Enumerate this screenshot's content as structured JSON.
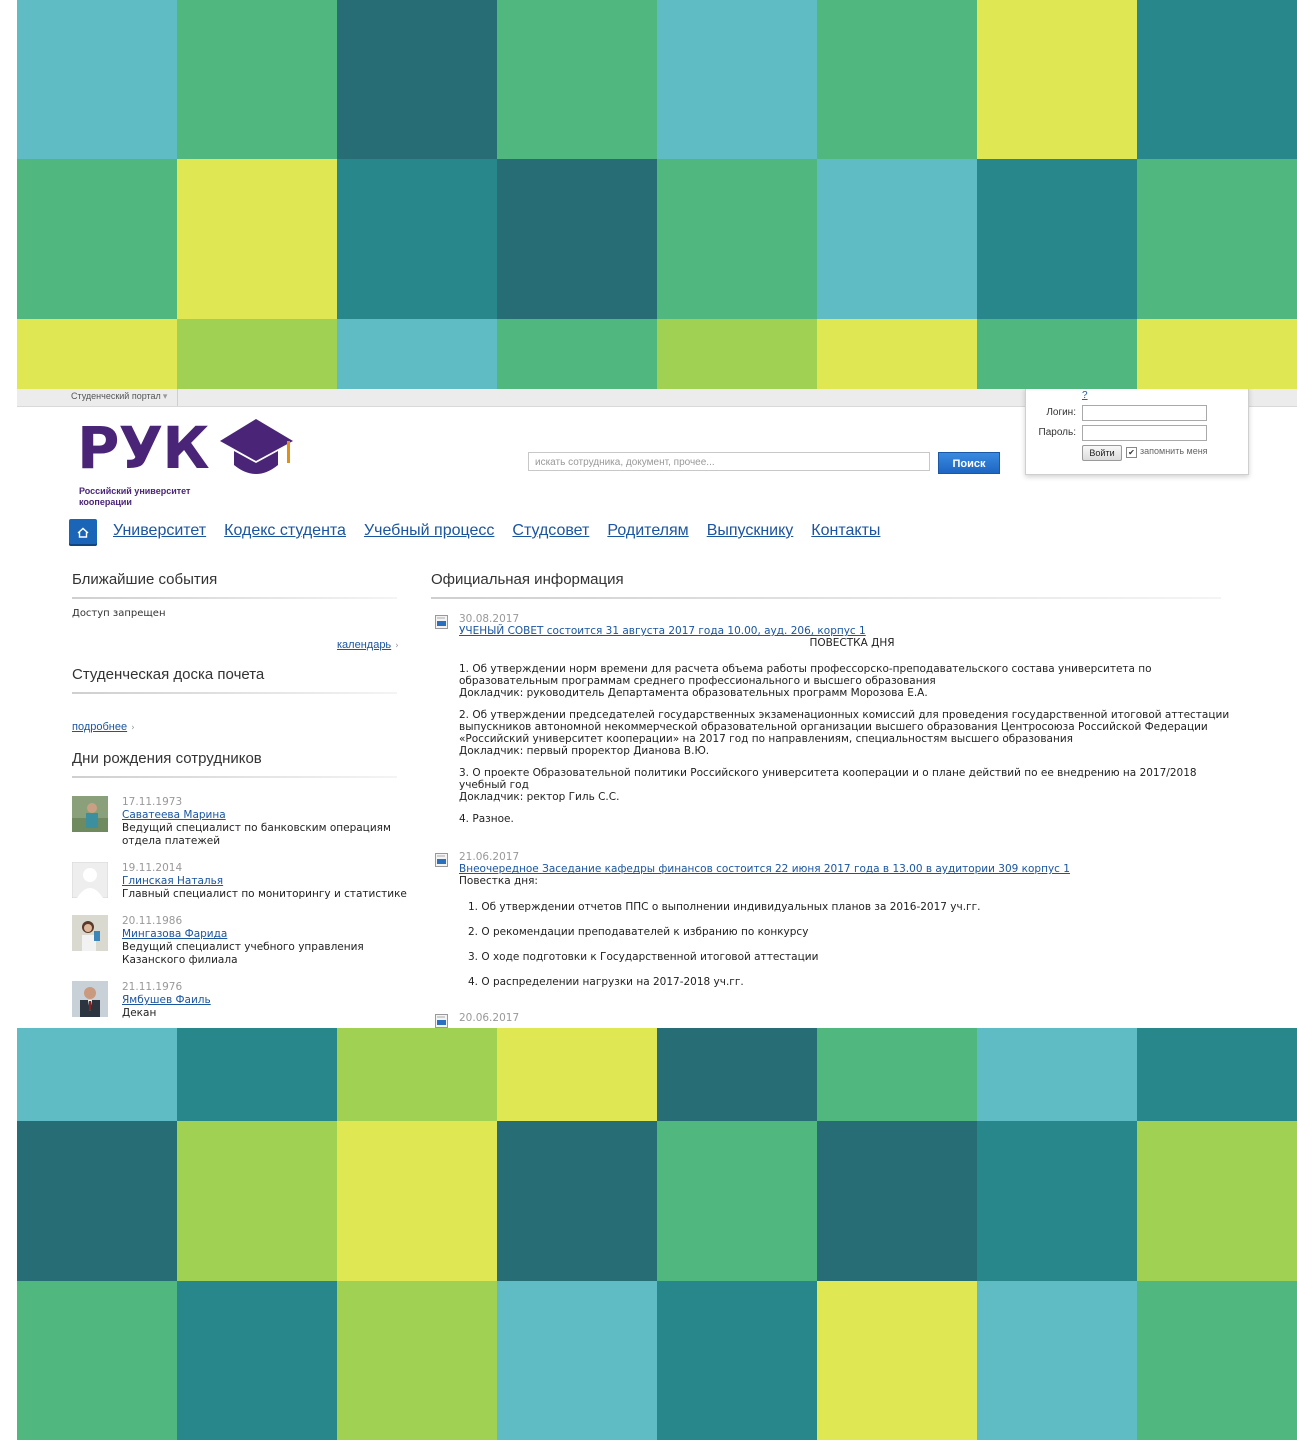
{
  "mosaic": {
    "top_rows": [
      [
        "#5fbcc4",
        "#50b87e",
        "#276d75",
        "#50b87e",
        "#5fbcc4",
        "#50b87e",
        "#dfe852",
        "#27878b"
      ],
      [
        "#50b87e",
        "#dfe852",
        "#27878b",
        "#276d75",
        "#50b87e",
        "#5fbcc4",
        "#27878b",
        "#50b87e"
      ],
      [
        "#dfe852",
        "#a0d153",
        "#5fbcc4",
        "#50b87e",
        "#a0d153",
        "#dfe852",
        "#50b87e",
        "#dfe852"
      ]
    ],
    "bottom_rows": [
      [
        "#5fbcc4",
        "#27878b",
        "#a0d153",
        "#dfe852",
        "#276d75",
        "#50b87e",
        "#5fbcc4",
        "#27878b"
      ],
      [
        "#276d75",
        "#a0d153",
        "#dfe852",
        "#276d75",
        "#50b87e",
        "#276d75",
        "#27878b",
        "#a0d153"
      ],
      [
        "#50b87e",
        "#27878b",
        "#a0d153",
        "#5fbcc4",
        "#27878b",
        "#dfe852",
        "#5fbcc4",
        "#50b87e"
      ]
    ]
  },
  "portal_bar": {
    "label": "Студенческий портал"
  },
  "login": {
    "help": "?",
    "login_label": "Логин:",
    "password_label": "Пароль:",
    "login_button": "Войти",
    "remember_label": "запомнить меня",
    "remember_checked": true
  },
  "logo": {
    "letters": "РУК",
    "tagline": "Российский университет кооперации",
    "brand_color": "#4a2577",
    "accent_color": "#e0901a"
  },
  "search": {
    "placeholder": "искать сотрудника, документ, прочее...",
    "button": "Поиск"
  },
  "nav": {
    "items": [
      "Университет",
      "Кодекс студента",
      "Учебный процесс",
      "Студсовет",
      "Родителям",
      "Выпускнику",
      "Контакты"
    ]
  },
  "sidebar": {
    "events": {
      "title": "Ближайшие события",
      "text": "Доступ запрещен",
      "calendar_link": "календарь"
    },
    "honor": {
      "title": "Студенческая доска почета",
      "more_link": "подробнее"
    },
    "birthdays": {
      "title": "Дни рождения сотрудников",
      "items": [
        {
          "date": "17.11.1973",
          "name": "Саватеева Марина",
          "position": "Ведущий специалист по банковским операциям отдела платежей"
        },
        {
          "date": "19.11.2014",
          "name": "Глинская Наталья",
          "position": "Главный специалист по мониторингу и статистике"
        },
        {
          "date": "20.11.1986",
          "name": "Мингазова Фарида",
          "position": "Ведущий специалист учебного управления Казанского филиала"
        },
        {
          "date": "21.11.1976",
          "name": "Ямбушев Фаиль",
          "position": "Декан"
        }
      ]
    }
  },
  "official": {
    "title": "Официальная информация",
    "news": [
      {
        "date": "30.08.2017",
        "title": "УЧЕНЫЙ СОВЕТ состоится 31 августа 2017 года 10.00, ауд. 206, корпус 1",
        "heading": "ПОВЕСТКА ДНЯ",
        "paragraphs": [
          "1. Об утверждении норм времени для расчета объема работы профессорско-преподавательского состава университета по образовательным программам среднего профессионального и высшего образования",
          "Докладчик: руководитель Департамента образовательных программ Морозова Е.А.",
          "2. Об утверждении председателей государственных экзаменационных комиссий для проведения государственной итоговой аттестации выпускников автономной некоммерческой образовательной организации высшего образования Центросоюза Российской Федерации «Российский университет кооперации» на 2017 год по направлениям, специальностям высшего образования",
          "Докладчик: первый проректор Дианова В.Ю.",
          "3. О проекте Образовательной политики Российского университета кооперации и о плане действий по ее внедрению на 2017/2018 учебный год",
          "Докладчик: ректор Гиль С.С.",
          "4. Разное."
        ]
      },
      {
        "date": "21.06.2017",
        "title": "Внеочередное Заседание кафедры финансов состоится 22 июня 2017 года в 13.00 в аудитории 309 корпус 1",
        "heading": "Повестка дня:",
        "items": [
          "1. Об утверждении отчетов ППС  о выполнении индивидуальных планов за 2016-2017 уч.гг.",
          "2. О рекомендации преподавателей к избранию по конкурсу",
          "3. О ходе подготовки к Государственной итоговой аттестации",
          "4. О распределении нагрузки на 2017-2018 уч.гг."
        ]
      },
      {
        "date": "20.06.2017"
      }
    ]
  }
}
